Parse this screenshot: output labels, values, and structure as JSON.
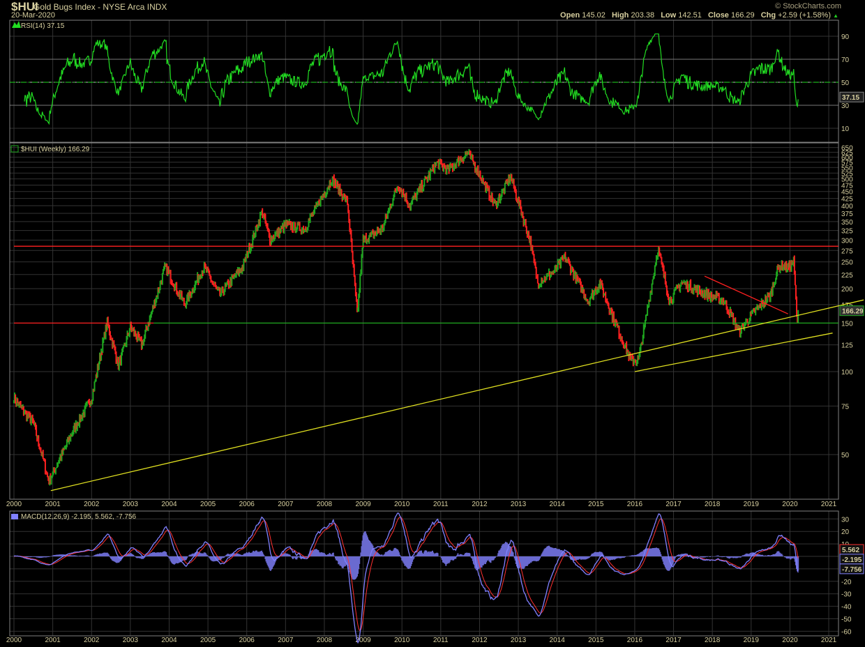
{
  "header": {
    "symbol": "$HUI",
    "name": "Gold Bugs Index - NYSE Arca INDX",
    "date": "20-Mar-2020",
    "brand": "© StockCharts.com",
    "open_label": "Open",
    "open": "145.02",
    "high_label": "High",
    "high": "203.38",
    "low_label": "Low",
    "low": "142.51",
    "close_label": "Close",
    "close": "166.29",
    "chg_label": "Chg",
    "chg": "+2.59 (+1.58%)"
  },
  "colors": {
    "up": "#1fa81f",
    "down": "#ff2020",
    "rsi": "#22dd22",
    "macd": "#8080ff",
    "signal": "#ff3030",
    "hist": "#6a6ad0",
    "trend": "#e0e020",
    "grid": "#333333",
    "border": "#808080"
  },
  "chart_data": [
    {
      "type": "line",
      "title": "RSI(14) 37.15",
      "last_value": "37.15",
      "ylim": [
        0,
        100
      ],
      "ticks": [
        10,
        30,
        50,
        70,
        90
      ],
      "levels": [
        30,
        50,
        70
      ]
    },
    {
      "type": "ohlc",
      "title": "$HUI (Weekly) 166.29",
      "scale": "log",
      "last_value": "166.29",
      "ylim": [
        36,
        680
      ],
      "ticks": [
        50,
        75,
        100,
        125,
        150,
        175,
        200,
        225,
        250,
        275,
        300,
        325,
        350,
        375,
        400,
        425,
        450,
        475,
        500,
        525,
        550,
        575,
        600,
        625,
        650
      ],
      "x_ticks": [
        "2000",
        "2001",
        "2002",
        "2003",
        "2004",
        "2005",
        "2006",
        "2007",
        "2008",
        "2009",
        "2010",
        "2011",
        "2012",
        "2013",
        "2014",
        "2015",
        "2016",
        "2017",
        "2018",
        "2019",
        "2020",
        "2021"
      ],
      "price_anchors": [
        [
          2000.0,
          80
        ],
        [
          2000.5,
          65
        ],
        [
          2000.9,
          40
        ],
        [
          2001.5,
          60
        ],
        [
          2002.0,
          80
        ],
        [
          2002.4,
          150
        ],
        [
          2002.7,
          105
        ],
        [
          2003.0,
          145
        ],
        [
          2003.3,
          125
        ],
        [
          2003.9,
          240
        ],
        [
          2004.4,
          175
        ],
        [
          2004.9,
          240
        ],
        [
          2005.3,
          190
        ],
        [
          2005.9,
          240
        ],
        [
          2006.4,
          380
        ],
        [
          2006.6,
          300
        ],
        [
          2007.0,
          340
        ],
        [
          2007.5,
          330
        ],
        [
          2007.9,
          420
        ],
        [
          2008.2,
          500
        ],
        [
          2008.6,
          410
        ],
        [
          2008.85,
          160
        ],
        [
          2009.0,
          300
        ],
        [
          2009.5,
          330
        ],
        [
          2009.9,
          480
        ],
        [
          2010.2,
          400
        ],
        [
          2010.9,
          570
        ],
        [
          2011.2,
          540
        ],
        [
          2011.7,
          620
        ],
        [
          2012.0,
          520
        ],
        [
          2012.4,
          400
        ],
        [
          2012.8,
          510
        ],
        [
          2013.3,
          300
        ],
        [
          2013.5,
          210
        ],
        [
          2013.9,
          230
        ],
        [
          2014.2,
          260
        ],
        [
          2014.8,
          180
        ],
        [
          2015.1,
          210
        ],
        [
          2015.5,
          150
        ],
        [
          2015.9,
          110
        ],
        [
          2016.1,
          110
        ],
        [
          2016.6,
          280
        ],
        [
          2016.9,
          180
        ],
        [
          2017.2,
          210
        ],
        [
          2017.9,
          190
        ],
        [
          2018.3,
          180
        ],
        [
          2018.7,
          140
        ],
        [
          2019.0,
          160
        ],
        [
          2019.5,
          190
        ],
        [
          2019.7,
          240
        ],
        [
          2020.0,
          240
        ],
        [
          2020.1,
          250
        ],
        [
          2020.19,
          145
        ],
        [
          2020.22,
          166.29
        ]
      ],
      "horizontal_lines": [
        {
          "price": 285,
          "from": 2000,
          "to": 2021.3,
          "color": "#ff2020"
        },
        {
          "price": 150,
          "from": 2000,
          "to": 2003.6,
          "color": "#ff2020"
        },
        {
          "price": 150,
          "from": 2003.6,
          "to": 2021.3,
          "color": "#1fa81f"
        }
      ],
      "trendlines": [
        {
          "from": [
            2000.95,
            37
          ],
          "to": [
            2021.9,
            182
          ],
          "color": "#e0e020"
        },
        {
          "from": [
            2016.0,
            100
          ],
          "to": [
            2021.1,
            138
          ],
          "color": "#e0e020"
        },
        {
          "from": [
            2017.8,
            222
          ],
          "to": [
            2019.95,
            162
          ],
          "color": "#ff2020"
        }
      ]
    },
    {
      "type": "line",
      "title": "MACD(12,26,9) -2.195, 5.562, -7.756",
      "macd": "-2.195",
      "signal": "5.562",
      "histogram": "-7.756",
      "ylim": [
        -62,
        35
      ],
      "ticks": [
        30,
        20,
        10,
        0,
        -10,
        -20,
        -30,
        -40,
        -50,
        -60
      ]
    }
  ]
}
